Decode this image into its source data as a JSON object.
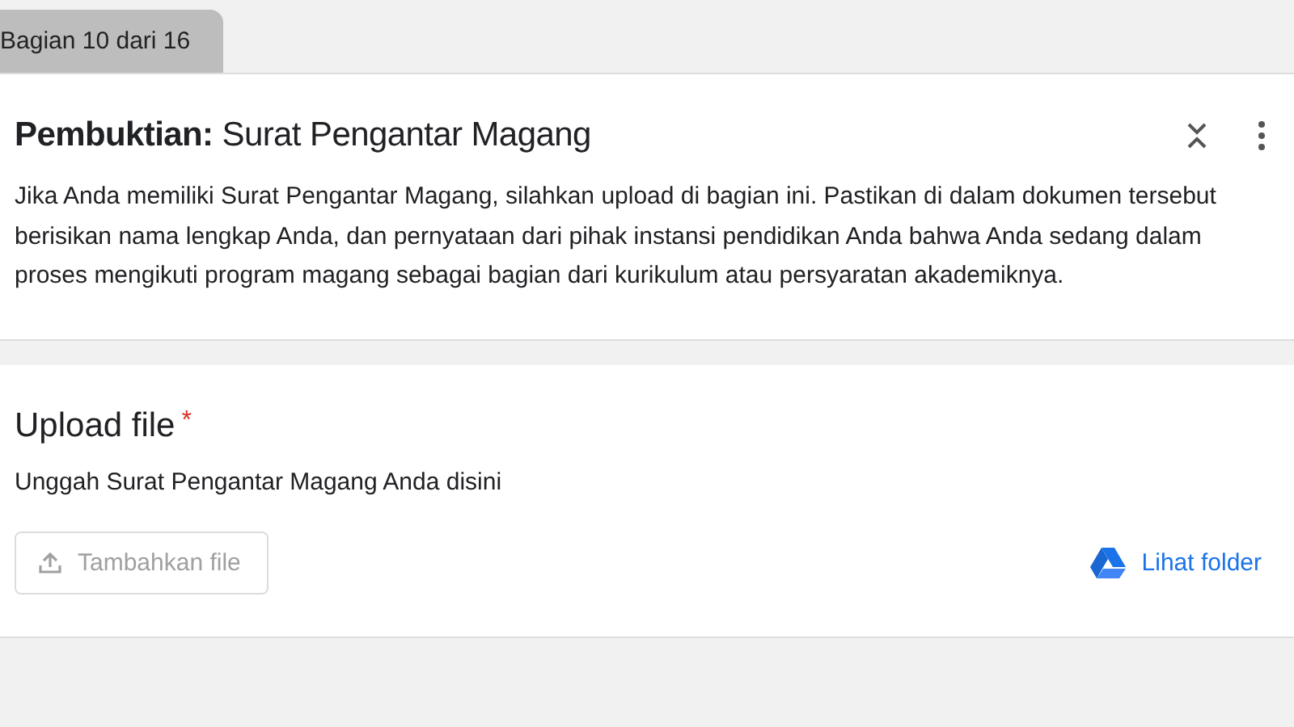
{
  "section_tab": {
    "label": "Bagian 10 dari 16"
  },
  "section": {
    "title": "**Pembuktian:** Surat Pengantar Magang",
    "description": "Jika Anda memiliki Surat Pengantar Magang, silahkan upload di bagian ini. Pastikan di dalam dokumen tersebut berisikan nama lengkap Anda, dan pernyataan dari pihak instansi pendidikan Anda bahwa Anda sedang dalam proses mengikuti program magang sebagai bagian dari kurikulum atau persyaratan akademiknya."
  },
  "question": {
    "title": "Upload file",
    "required": true,
    "required_mark": "*",
    "description": "Unggah Surat Pengantar Magang Anda disini",
    "upload_button": {
      "label": "Tambahkan file",
      "disabled": true
    },
    "folder_link": {
      "label": "Lihat folder"
    }
  }
}
